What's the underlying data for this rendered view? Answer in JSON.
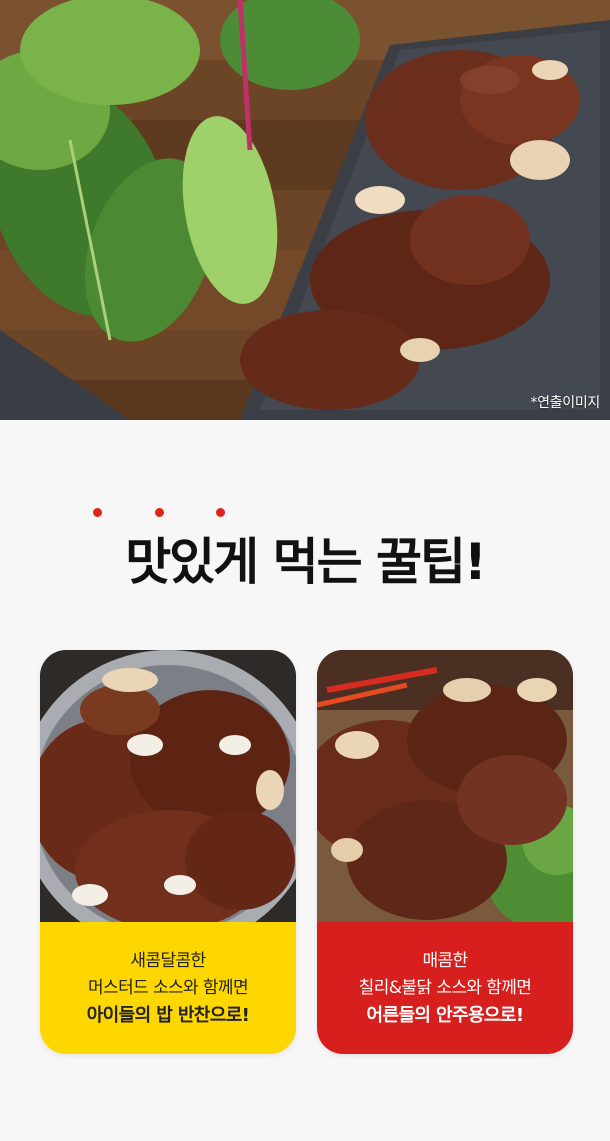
{
  "hero": {
    "caption": "*연출이미지"
  },
  "title": {
    "text": "맛있게 먹는 꿀팁!",
    "emphasis_dots_color": "#e2231a"
  },
  "cards": [
    {
      "line1": "새콤달콤한",
      "line2": "머스터드 소스와 함께면",
      "line3": "아이들의 밥 반찬으로!",
      "bg_color": "#fed700"
    },
    {
      "line1": "매콤한",
      "line2": "칠리&불닭 소스와 함께면",
      "line3": "어른들의 안주용으로!",
      "bg_color": "#d7201d"
    }
  ]
}
